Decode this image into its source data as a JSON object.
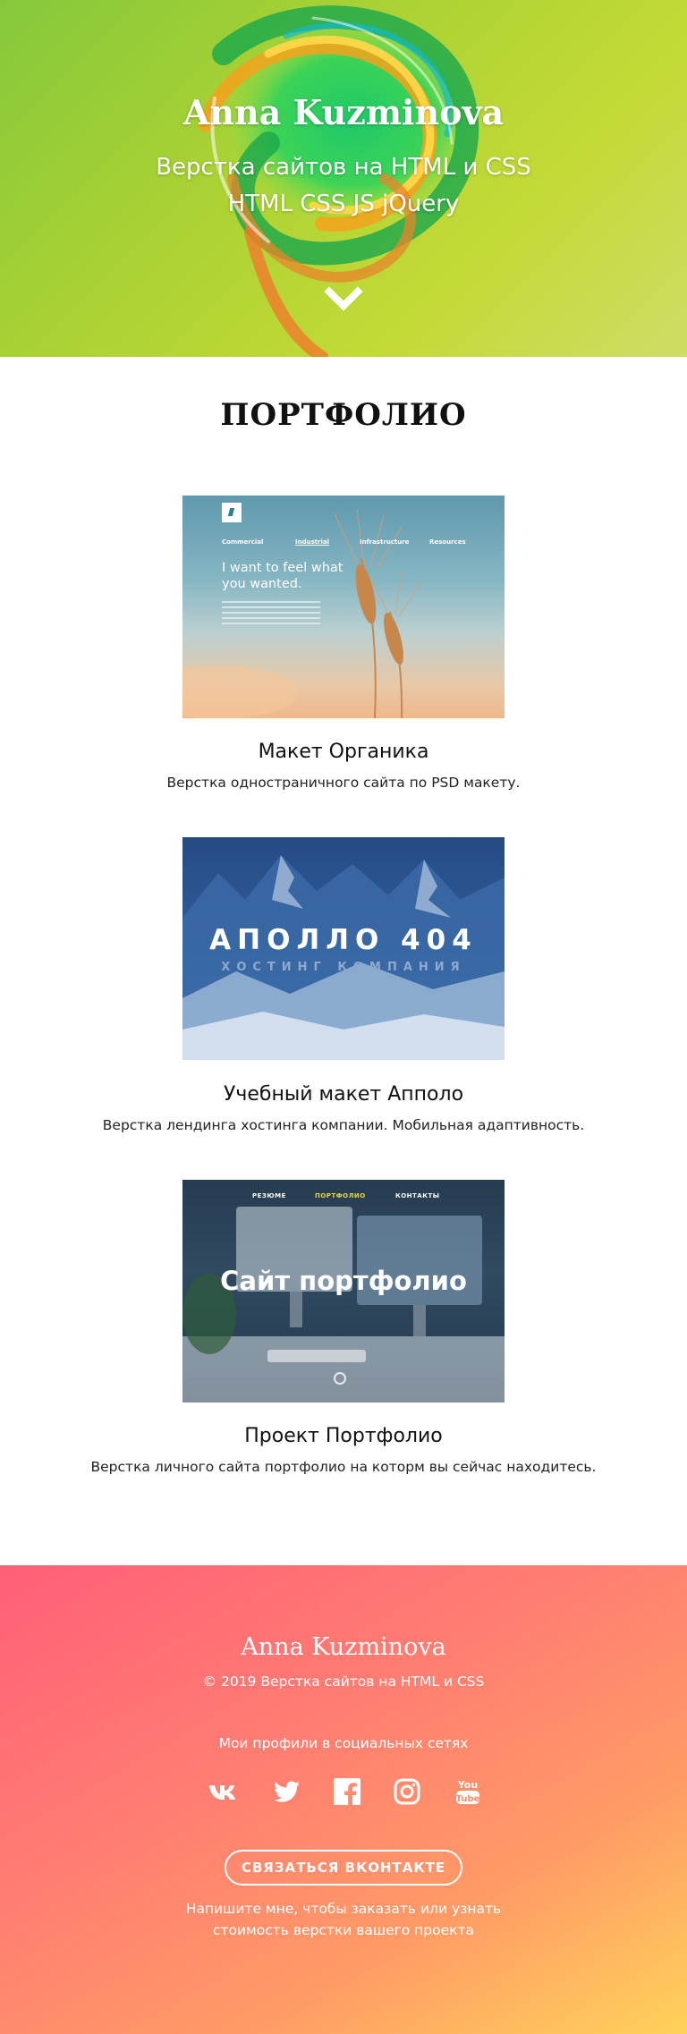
{
  "header": {
    "name": "Anna Kuzminova",
    "subtitle_line1": "Верстка сайтов на HTML и CSS",
    "subtitle_line2": "HTML CSS JS jQuery"
  },
  "portfolio": {
    "title": "ПОРТФОЛИО",
    "works": [
      {
        "title": "Макет Органика",
        "description": "Верстка одностраничного сайта по PSD макету.",
        "thumb": {
          "nav": [
            "Commercial",
            "Industrial",
            "Infrastructure",
            "Resources"
          ],
          "headline": "I want to feel what you wanted."
        }
      },
      {
        "title": "Учебный макет Апполо",
        "description": "Верстка лендинга хостинга компании. Мобильная адаптивность.",
        "thumb": {
          "brand": "АПОЛЛО 404",
          "tagline": "ХОСТИНГ КОМПАНИЯ"
        }
      },
      {
        "title": "Проект Портфолио",
        "description": "Верстка личного сайта портфолио на которм вы сейчас находитесь.",
        "thumb": {
          "nav": [
            "РЕЗЮМЕ",
            "ПОРТФОЛИО",
            "КОНТАКТЫ"
          ],
          "headline": "Сайт портфолио"
        }
      }
    ]
  },
  "footer": {
    "name": "Anna Kuzminova",
    "copyright": "© 2019 Верстка сайтов на HTML и CSS",
    "profiles_label": "Мои профили в социальных сетях",
    "social_icons": [
      "vk-icon",
      "twitter-icon",
      "facebook-icon",
      "instagram-icon",
      "youtube-icon"
    ],
    "contact_button": "СВЯЗАТЬСЯ ВКОНТАКТЕ",
    "note_line1": "Напишите мне, чтобы заказать или узнать",
    "note_line2": "стоимость верстки вашего проекта"
  },
  "colors": {
    "header_gradient": [
      "#86c83c",
      "#cfdc66"
    ],
    "footer_gradient": [
      "#ff5f78",
      "#ffd25a"
    ],
    "text_dark": "#111111",
    "text_light": "#ffffff"
  }
}
